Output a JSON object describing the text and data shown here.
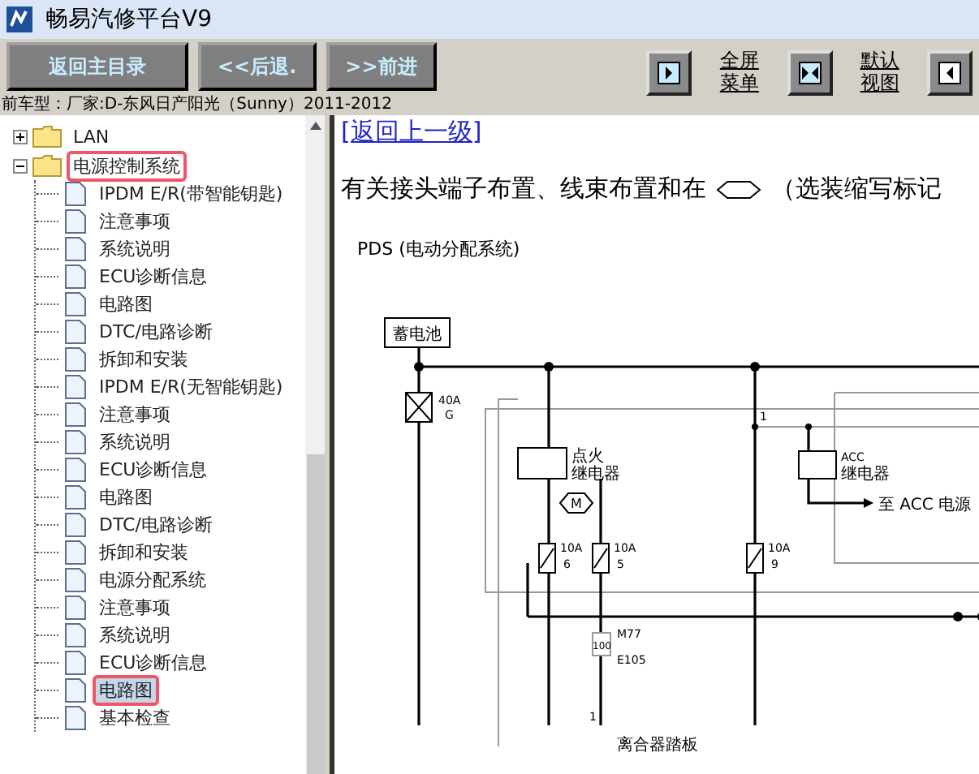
{
  "window": {
    "title": "畅易汽修平台V9"
  },
  "toolbar": {
    "buttons": [
      "返回主目录",
      "<<后退.",
      ">>前进"
    ],
    "view_links": [
      "全屏菜单",
      "默认视图"
    ]
  },
  "vehicle": "前车型：厂家:D-东风日产阳光（Sunny）2011-2012",
  "tree": [
    {
      "label": "LAN",
      "expanded": false,
      "marked": false
    },
    {
      "label": "电源控制系统",
      "expanded": true,
      "marked": true,
      "children": [
        {
          "label": "IPDM E/R(带智能钥匙)",
          "selected": false,
          "marked": false
        },
        {
          "label": "注意事项",
          "selected": false,
          "marked": false
        },
        {
          "label": "系统说明",
          "selected": false,
          "marked": false
        },
        {
          "label": "ECU诊断信息",
          "selected": false,
          "marked": false
        },
        {
          "label": "电路图",
          "selected": false,
          "marked": false
        },
        {
          "label": "DTC/电路诊断",
          "selected": false,
          "marked": false
        },
        {
          "label": "拆卸和安装",
          "selected": false,
          "marked": false
        },
        {
          "label": "IPDM E/R(无智能钥匙)",
          "selected": false,
          "marked": false
        },
        {
          "label": "注意事项",
          "selected": false,
          "marked": false
        },
        {
          "label": "系统说明",
          "selected": false,
          "marked": false
        },
        {
          "label": "ECU诊断信息",
          "selected": false,
          "marked": false
        },
        {
          "label": "电路图",
          "selected": false,
          "marked": false
        },
        {
          "label": "DTC/电路诊断",
          "selected": false,
          "marked": false
        },
        {
          "label": "拆卸和安装",
          "selected": false,
          "marked": false
        },
        {
          "label": "电源分配系统",
          "selected": false,
          "marked": false
        },
        {
          "label": "注意事项",
          "selected": false,
          "marked": false
        },
        {
          "label": "系统说明",
          "selected": false,
          "marked": false
        },
        {
          "label": "ECU诊断信息",
          "selected": false,
          "marked": false
        },
        {
          "label": "电路图",
          "selected": true,
          "marked": true
        },
        {
          "label": "基本检查",
          "selected": false,
          "marked": false
        }
      ]
    }
  ],
  "document": {
    "back_link": "[返回上一级]",
    "intro_before": "有关接头端子布置、线束布置和在",
    "intro_after": "（选装缩写标记",
    "diagram_title": "PDS (电动分配系统)",
    "diagram": {
      "battery": "蓄电池",
      "main_fuse": {
        "rating": "40A",
        "code": "G"
      },
      "bus_point": "1",
      "ignition_relay": [
        "点火",
        "继电器"
      ],
      "acc_relay": [
        "ACC",
        "继电器"
      ],
      "motor": "M",
      "acc_output": "至 ACC 电源",
      "fuses": [
        {
          "rating": "10A",
          "code": "6"
        },
        {
          "rating": "10A",
          "code": "5"
        },
        {
          "rating": "10A",
          "code": "9"
        }
      ],
      "connector_top": "M77",
      "joint": "100",
      "connector_bottom": "E105",
      "switch_pin": "1",
      "switch": "离合器踏板"
    }
  }
}
